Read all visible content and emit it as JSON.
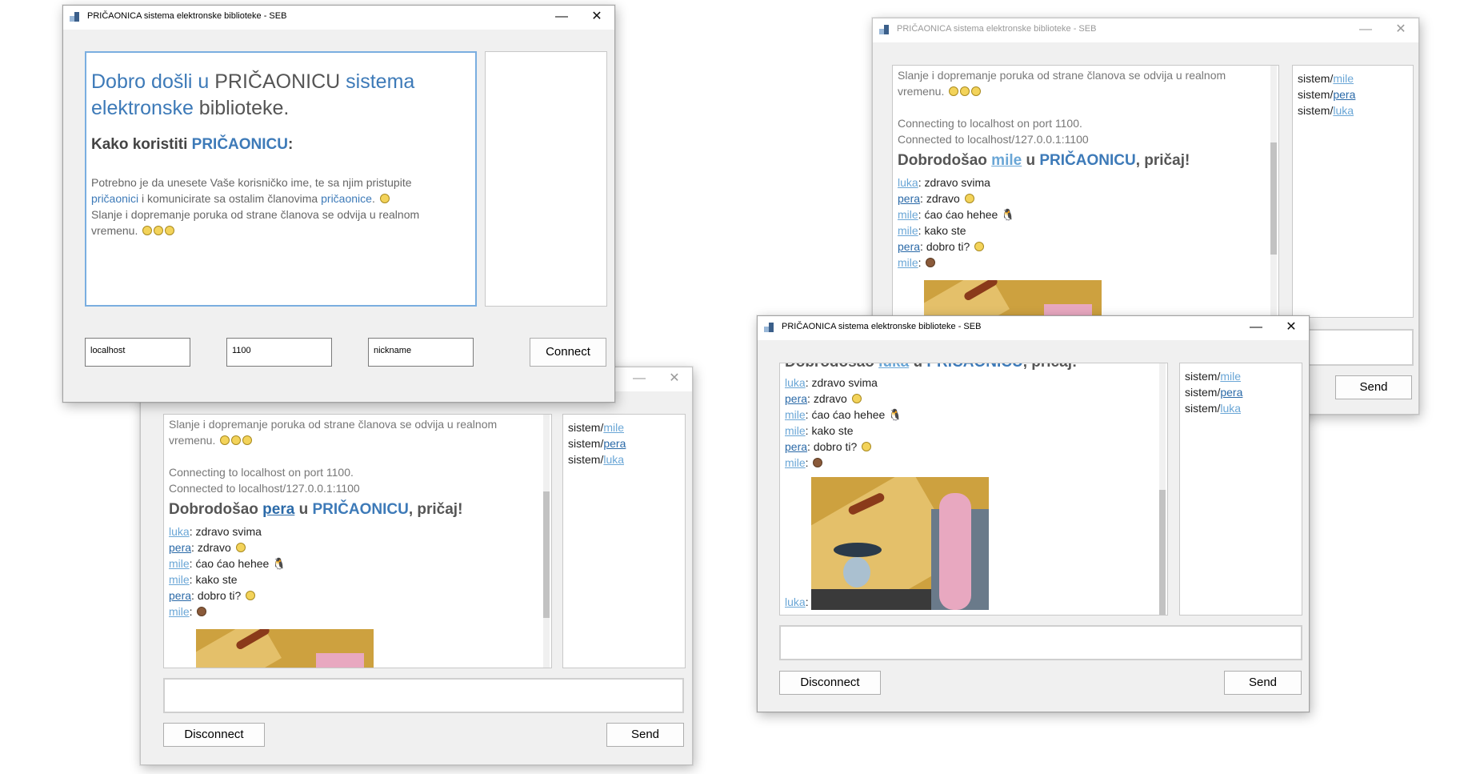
{
  "app_title": "PRIČAONICA sistema elektronske biblioteke - SEB",
  "controls": {
    "minimize": "—",
    "close": "✕"
  },
  "login": {
    "welcome_1": "Dobro došli u ",
    "welcome_2": "PRIČAONICU",
    "welcome_3": " sistema",
    "welcome_4": "elektronske",
    "welcome_5": " biblioteke.",
    "howto_1": "Kako koristiti ",
    "howto_2": "PRIČAONICU",
    "howto_3": ":",
    "info_1": "Potrebno je da unesete Vaše korisničko ime, te sa njim pristupite",
    "info_link1": "pričaonici",
    "info_2": " i komunicirate sa ostalim članovima ",
    "info_link2": "pričaonice",
    "info_3": ".",
    "info_4": "Slanje i dopremanje poruka od strane članova se odvija u realnom",
    "info_5": "vremenu.",
    "host": "localhost",
    "port": "1100",
    "nickname": "nickname",
    "connect": "Connect"
  },
  "chat": {
    "line_realtime_1": "Slanje i dopremanje poruka od strane članova se odvija u realnom",
    "line_realtime_2": "vremenu.",
    "connecting": "Connecting to localhost on port 1100.",
    "connected": "Connected to localhost/127.0.0.1:1100",
    "welcome_a": "Dobrodošao ",
    "welcome_b": " u ",
    "welcome_c": "PRIČAONICU",
    "welcome_d": ", pričaj!",
    "messages": [
      {
        "user": "luka",
        "text": "zdravo svima"
      },
      {
        "user": "pera",
        "text": "zdravo"
      },
      {
        "user": "mile",
        "text": "ćao ćao hehee"
      },
      {
        "user": "mile",
        "text": "kako ste"
      },
      {
        "user": "pera",
        "text": "dobro ti?"
      },
      {
        "user": "mile",
        "text": ""
      }
    ],
    "last_user": "luka",
    "users_prefix": "sistem/",
    "users": [
      "mile",
      "pera",
      "luka"
    ],
    "disconnect": "Disconnect",
    "send": "Send"
  },
  "sessions": {
    "mile": "mile",
    "pera": "pera",
    "luka": "luka"
  },
  "colors": {
    "accent": "#3d7ab8",
    "link": "#6aa6d6"
  }
}
